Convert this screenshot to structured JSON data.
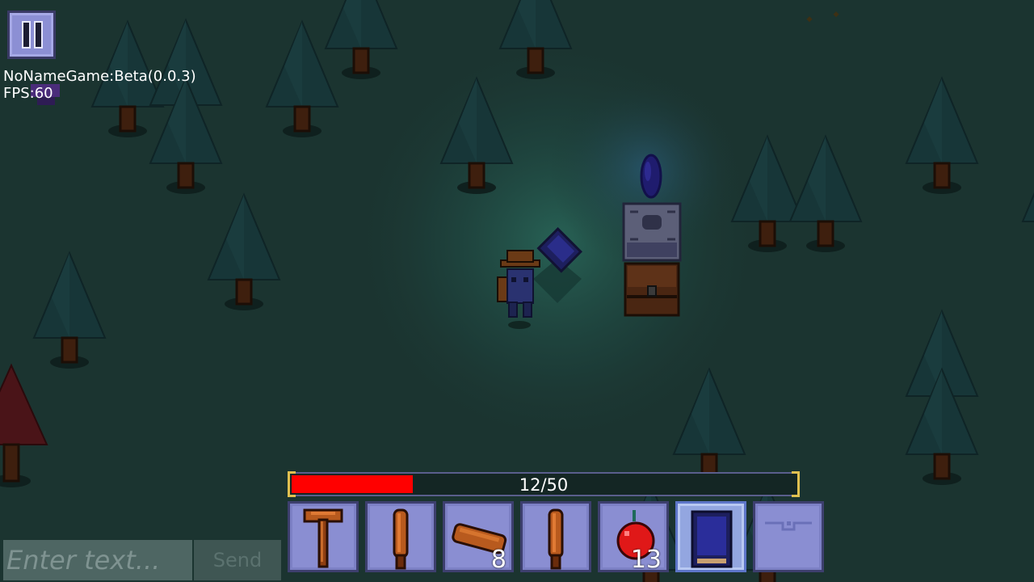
{
  "hud": {
    "version": "NoNameGame:Beta(0.0.3)",
    "fps": "FPS:60"
  },
  "health": {
    "text": "12/50",
    "current": 12,
    "max": 50,
    "color": "#ff0000"
  },
  "hotbar": [
    {
      "item": "hammer-icon",
      "count": ""
    },
    {
      "item": "wooden-club-icon",
      "count": ""
    },
    {
      "item": "log-icon",
      "count": "8"
    },
    {
      "item": "wooden-club-icon",
      "count": ""
    },
    {
      "item": "apple-icon",
      "count": "13"
    },
    {
      "item": "spellbook-icon",
      "count": "",
      "selected": true
    },
    {
      "item": "empty-slot",
      "count": ""
    }
  ],
  "chat": {
    "placeholder": "Enter text...",
    "send_label": "Send"
  },
  "colors": {
    "ground": "#1b3430",
    "tree_foliage": "#173638",
    "tree_trunk": "#3e1f0e",
    "red_tree": "#4a1418",
    "slot": "#8a8ed2"
  }
}
